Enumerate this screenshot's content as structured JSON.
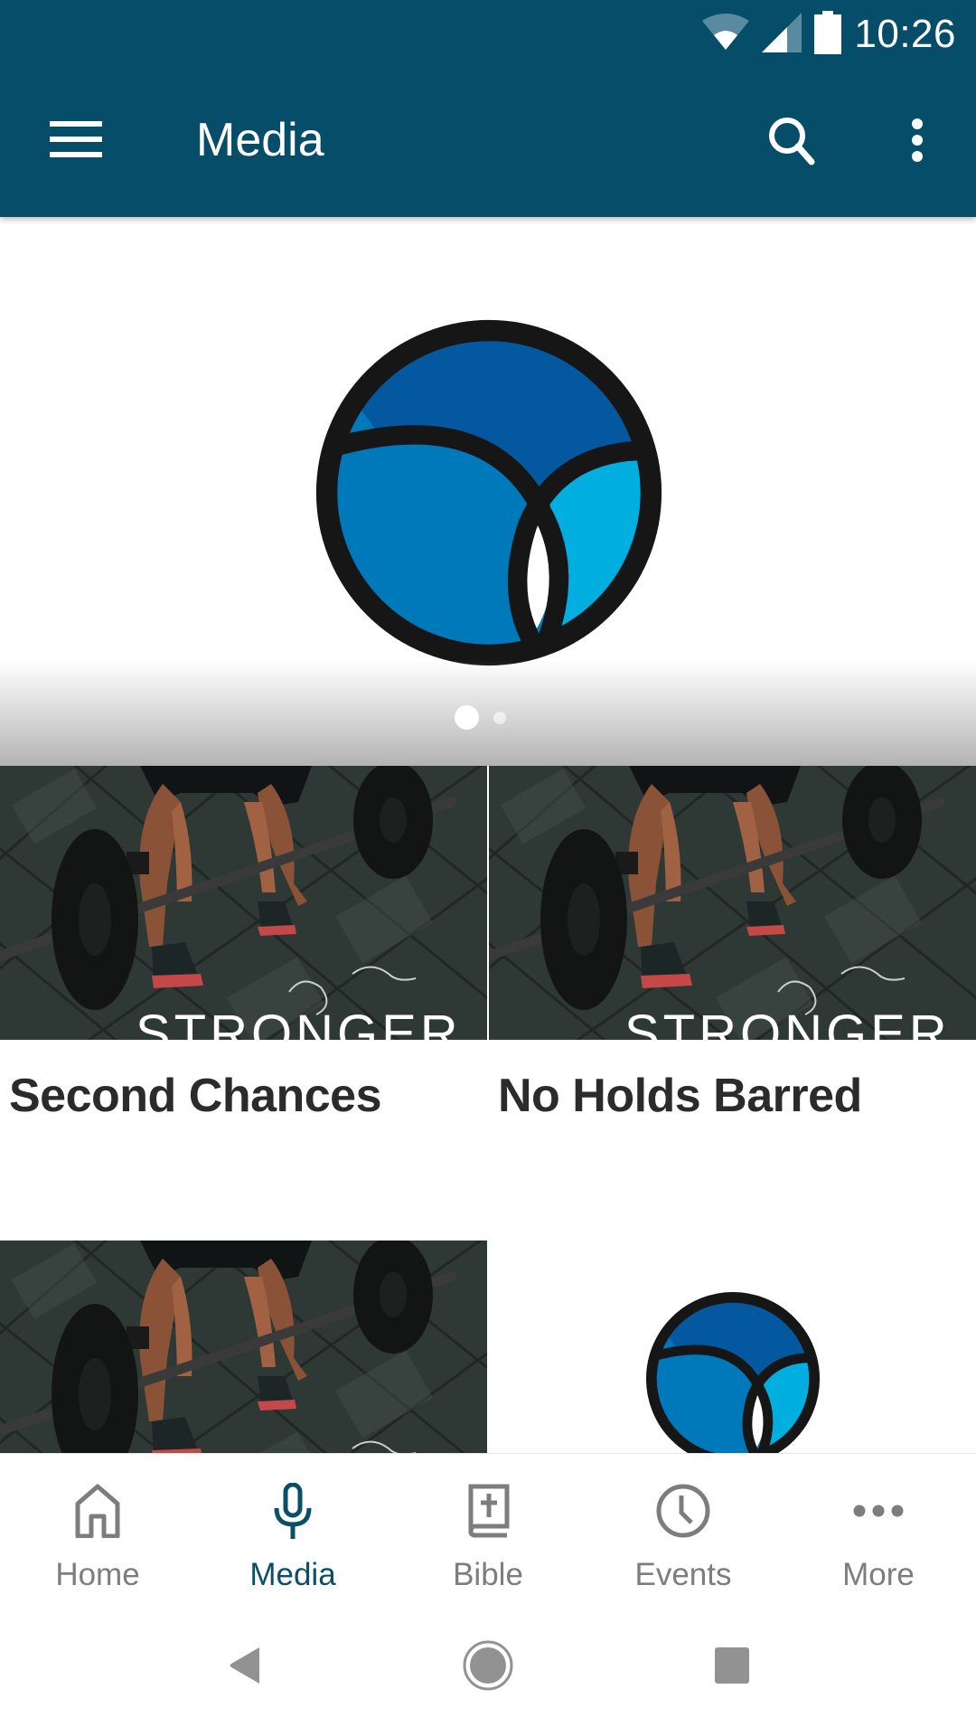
{
  "status_bar": {
    "time": "10:26",
    "icons": [
      "wifi-icon",
      "cellular-signal-icon",
      "battery-icon"
    ]
  },
  "app_bar": {
    "title": "Media",
    "left_icon": "hamburger-menu-icon",
    "right_icons": [
      "search-icon",
      "overflow-menu-icon"
    ]
  },
  "carousel": {
    "slides": [
      {
        "image": "church-logo"
      },
      {
        "image": "unknown"
      }
    ],
    "active_index": 0,
    "slide_count": 2
  },
  "media_grid": {
    "items": [
      {
        "title": "Second Chances",
        "image": "stronger-series-barbell",
        "image_text": "STRONGER"
      },
      {
        "title": "No Holds Barred",
        "image": "stronger-series-barbell",
        "image_text": "STRONGER"
      },
      {
        "title": "",
        "image": "stronger-series-barbell-partial"
      },
      {
        "title": "",
        "image": "church-logo"
      }
    ]
  },
  "bottom_nav": {
    "items": [
      {
        "label": "Home",
        "icon": "home-icon",
        "active": false
      },
      {
        "label": "Media",
        "icon": "microphone-icon",
        "active": true
      },
      {
        "label": "Bible",
        "icon": "bible-icon",
        "active": false
      },
      {
        "label": "Events",
        "icon": "clock-icon",
        "active": false
      },
      {
        "label": "More",
        "icon": "more-dots-icon",
        "active": false
      }
    ],
    "active_color": "#0a4f68",
    "inactive_color": "#7d7d7d"
  },
  "system_nav": {
    "buttons": [
      "back-icon",
      "home-circle-icon",
      "recents-icon"
    ]
  },
  "colors": {
    "app_bar": "#054d69",
    "logo_dark_blue": "#0458a0",
    "logo_mid_blue": "#0079bb",
    "logo_light_blue": "#00aee0",
    "logo_outline": "#161616"
  }
}
